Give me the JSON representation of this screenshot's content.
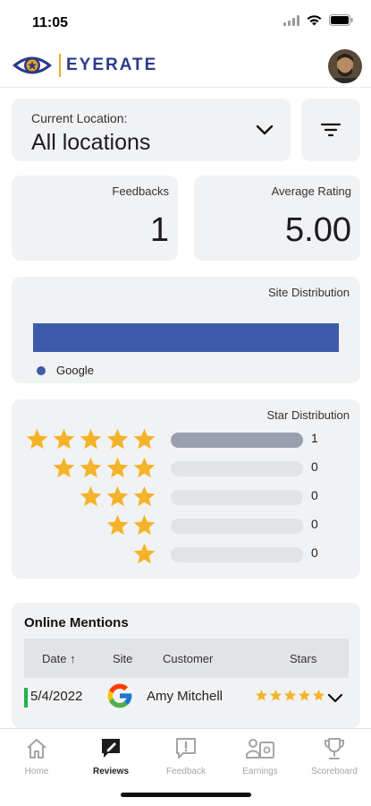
{
  "status_bar": {
    "time": "11:05"
  },
  "header": {
    "logo_text": "EYERATE"
  },
  "location": {
    "label": "Current Location:",
    "value": "All locations"
  },
  "stats": {
    "feedbacks_label": "Feedbacks",
    "feedbacks_value": "1",
    "rating_label": "Average Rating",
    "rating_value": "5.00"
  },
  "site_distribution": {
    "title": "Site Distribution",
    "legend": "Google",
    "color": "#3e5bab",
    "share": 1.0
  },
  "star_distribution": {
    "title": "Star Distribution",
    "rows": [
      {
        "stars": 5,
        "count": "1",
        "fill": 1.0
      },
      {
        "stars": 4,
        "count": "0",
        "fill": 0
      },
      {
        "stars": 3,
        "count": "0",
        "fill": 0
      },
      {
        "stars": 2,
        "count": "0",
        "fill": 0
      },
      {
        "stars": 1,
        "count": "0",
        "fill": 0
      }
    ],
    "star_color": "#f4b328"
  },
  "mentions": {
    "title": "Online Mentions",
    "columns": {
      "date": "Date",
      "site": "Site",
      "customer": "Customer",
      "stars": "Stars"
    },
    "rows": [
      {
        "date": "5/4/2022",
        "site": "google-icon",
        "customer": "Amy Mitchell",
        "stars": 5
      }
    ]
  },
  "tabs": [
    {
      "label": "Home",
      "icon": "home-icon"
    },
    {
      "label": "Reviews",
      "icon": "reviews-icon",
      "active": true
    },
    {
      "label": "Feedback",
      "icon": "feedback-icon"
    },
    {
      "label": "Earnings",
      "icon": "earnings-icon"
    },
    {
      "label": "Scoreboard",
      "icon": "trophy-icon"
    }
  ]
}
